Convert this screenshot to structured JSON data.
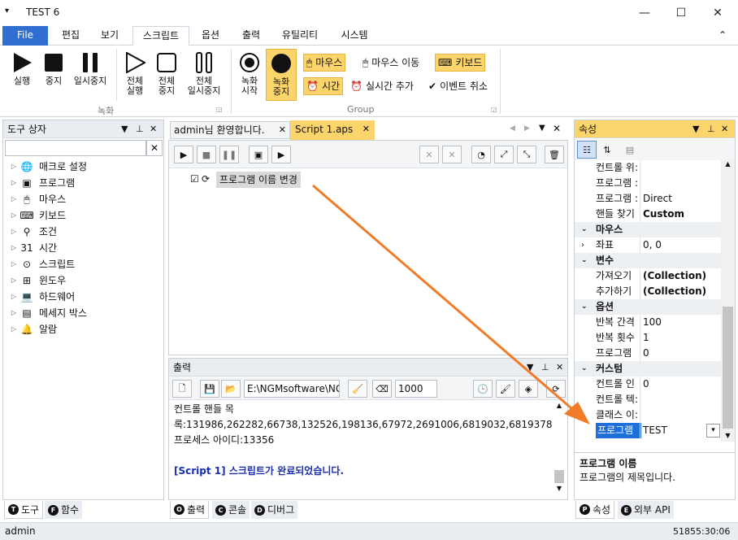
{
  "window": {
    "title": "TEST 6",
    "sysmenu_glyph": "▾",
    "minimize": "—",
    "maximize": "☐",
    "close": "✕"
  },
  "menu": {
    "tabs": [
      "File",
      "편집",
      "보기",
      "스크립트",
      "옵션",
      "출력",
      "유틸리티",
      "시스템"
    ],
    "collapse": "⌃"
  },
  "ribbon": {
    "run": "실행",
    "stop": "중지",
    "pause": "일시중지",
    "all_run": [
      "전체",
      "실행"
    ],
    "all_stop": [
      "전체",
      "중지"
    ],
    "all_pause": [
      "전체",
      "일시중지"
    ],
    "rec_start": [
      "녹화",
      "시작"
    ],
    "rec_stop": [
      "녹화",
      "중지"
    ],
    "group_record": "녹화",
    "group_group": "Group",
    "mouse": "마우스",
    "mouse_move": "마우스 이동",
    "keyboard": "키보드",
    "time": "시간",
    "realtime_add": "실시간 추가",
    "event_cancel": "이벤트 취소",
    "colors": {
      "highlight": "#fbd46b"
    }
  },
  "toolbox": {
    "title": "도구 상자",
    "search_value": "",
    "clear": "✕",
    "items": [
      {
        "label": "매크로 설정",
        "icon": "globe-icon",
        "glyph": "🌐"
      },
      {
        "label": "프로그램",
        "icon": "program-icon",
        "glyph": "▣"
      },
      {
        "label": "마우스",
        "icon": "mouse-icon",
        "glyph": "🖱"
      },
      {
        "label": "키보드",
        "icon": "keyboard-icon",
        "glyph": "⌨"
      },
      {
        "label": "조건",
        "icon": "condition-icon",
        "glyph": "⚲"
      },
      {
        "label": "시간",
        "icon": "calendar-icon",
        "glyph": "31"
      },
      {
        "label": "스크립트",
        "icon": "script-icon",
        "glyph": "⊙"
      },
      {
        "label": "윈도우",
        "icon": "windows-icon",
        "glyph": "⊞"
      },
      {
        "label": "하드웨어",
        "icon": "laptop-icon",
        "glyph": "💻"
      },
      {
        "label": "메세지 박스",
        "icon": "message-icon",
        "glyph": "▤"
      },
      {
        "label": "알람",
        "icon": "bell-icon",
        "glyph": "🔔"
      }
    ],
    "bottom_tabs": [
      {
        "letter": "T",
        "label": "도구"
      },
      {
        "letter": "F",
        "label": "함수"
      }
    ]
  },
  "editor": {
    "tabs": [
      {
        "label": "admin님 환영합니다."
      },
      {
        "label": "Script 1.aps"
      }
    ],
    "script_item": "프로그램 이름 변경"
  },
  "output": {
    "title": "출력",
    "path": "E:\\NGMsoftware\\NG",
    "count": "1000",
    "lines": [
      "컨트롤 핸들 목",
      "록:131986,262282,66738,132526,198136,67972,2691006,6819032,6819378",
      "프로세스 아이디:13356",
      "",
      "[Script 1] 스크립트가 완료되었습니다."
    ],
    "bottom_tabs": [
      {
        "letter": "O",
        "label": "출력"
      },
      {
        "letter": "C",
        "label": "콘솔"
      },
      {
        "letter": "D",
        "label": "디버그"
      }
    ]
  },
  "properties": {
    "title": "속성",
    "rows": [
      {
        "type": "prop",
        "k": "컨트롤 위:",
        "v": ""
      },
      {
        "type": "prop",
        "k": "프로그램 :",
        "v": ""
      },
      {
        "type": "prop",
        "k": "프로그램 :",
        "v": "Direct"
      },
      {
        "type": "prop",
        "k": "핸들 찾기",
        "v": "Custom",
        "bold": true
      },
      {
        "type": "cat",
        "k": "마우스"
      },
      {
        "type": "prop",
        "k": "좌표",
        "v": "0, 0",
        "expand": true
      },
      {
        "type": "cat",
        "k": "변수"
      },
      {
        "type": "prop",
        "k": "가져오기",
        "v": "(Collection)",
        "bold": true
      },
      {
        "type": "prop",
        "k": "추가하기",
        "v": "(Collection)",
        "bold": true
      },
      {
        "type": "cat",
        "k": "옵션"
      },
      {
        "type": "prop",
        "k": "반복 간격",
        "v": "100"
      },
      {
        "type": "prop",
        "k": "반복 횟수",
        "v": "1"
      },
      {
        "type": "prop",
        "k": "프로그램 ",
        "v": "0"
      },
      {
        "type": "cat",
        "k": "커스텀"
      },
      {
        "type": "prop",
        "k": "컨트롤 인",
        "v": "0"
      },
      {
        "type": "prop",
        "k": "컨트롤 텍:",
        "v": ""
      },
      {
        "type": "prop",
        "k": "클래스 이:",
        "v": ""
      },
      {
        "type": "prop",
        "k": "프로그램",
        "v": "TEST",
        "selected": true
      }
    ],
    "desc_title": "프로그램 이름",
    "desc_text": "프로그램의 제목입니다.",
    "bottom_tabs": [
      {
        "letter": "P",
        "label": "속성"
      },
      {
        "letter": "E",
        "label": "외부 API"
      }
    ]
  },
  "status": {
    "user": "admin",
    "clock": "51855:30:06"
  }
}
